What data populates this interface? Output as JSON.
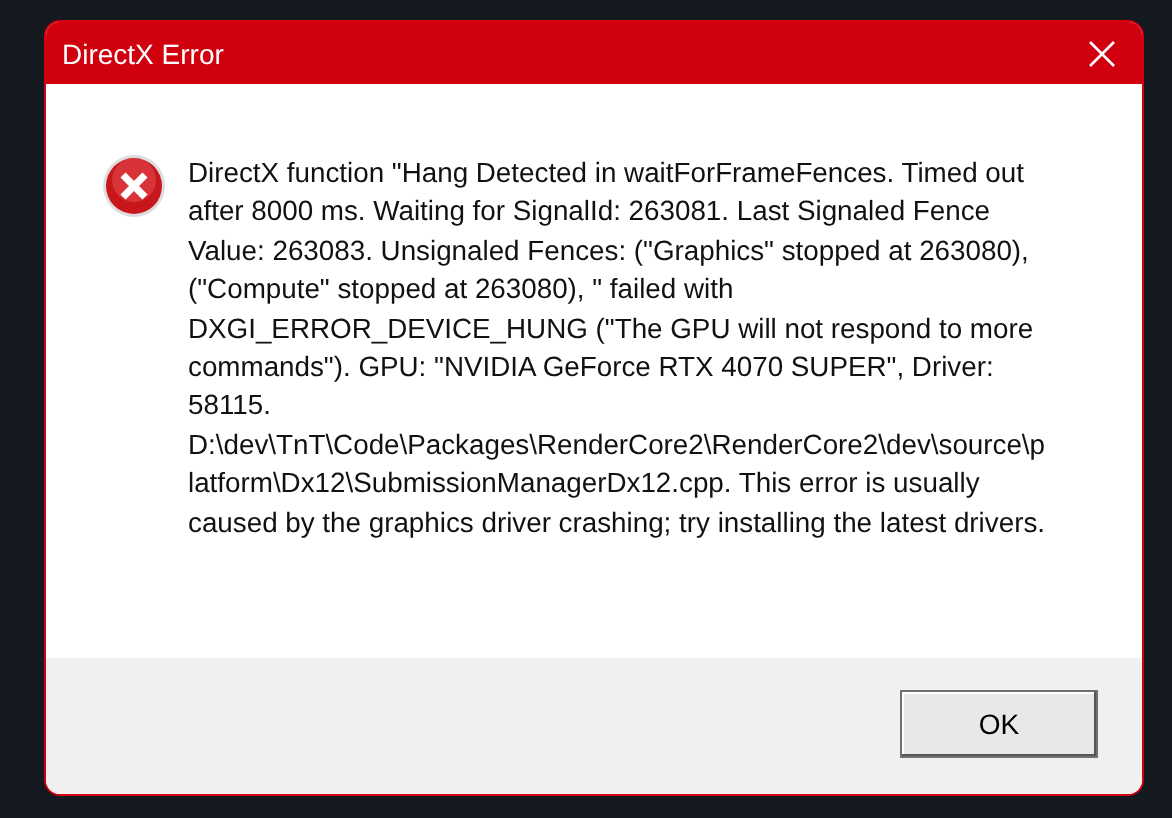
{
  "window": {
    "title": "DirectX Error"
  },
  "dialog": {
    "message": "DirectX function \"Hang Detected in waitForFrameFences. Timed out after 8000 ms. Waiting for SignalId: 263081. Last Signaled Fence Value: 263083. Unsignaled Fences: (\"Graphics\" stopped at 263080), (\"Compute\" stopped at 263080), \" failed with DXGI_ERROR_DEVICE_HUNG (\"The GPU will not respond to more commands\"). GPU: \"NVIDIA GeForce RTX 4070 SUPER\", Driver: 58115. D:\\dev\\TnT\\Code\\Packages\\RenderCore2\\RenderCore2\\dev\\source\\platform\\Dx12\\SubmissionManagerDx12.cpp. This error is usually caused by the graphics driver crashing; try installing the latest drivers."
  },
  "buttons": [
    "OK"
  ]
}
